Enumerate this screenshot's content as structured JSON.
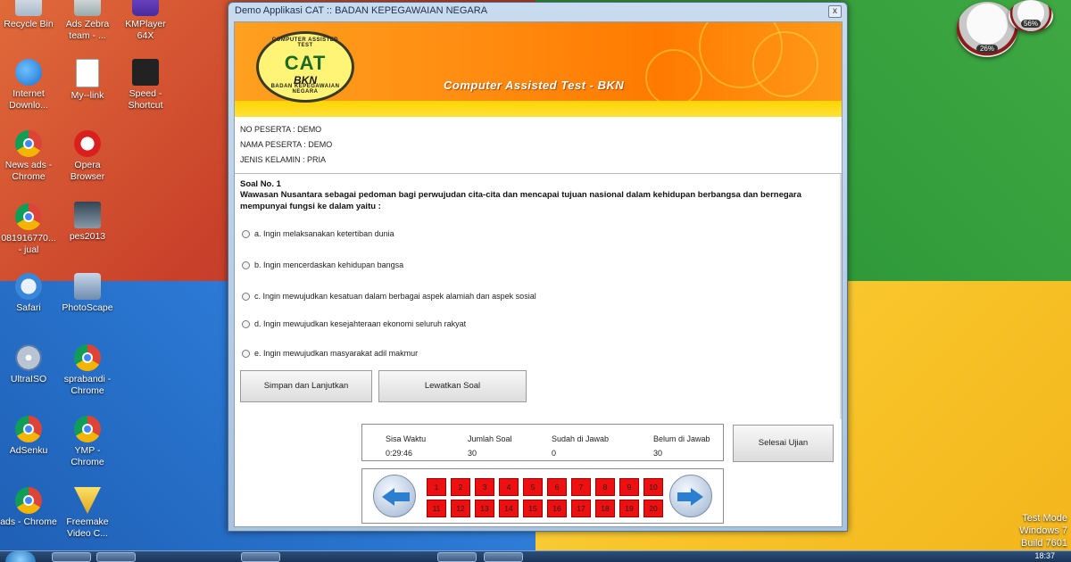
{
  "desktop": {
    "icons": [
      {
        "label": "Recycle Bin",
        "icon": "recycle-bin-icon"
      },
      {
        "label": "Ads Zebra team - ...",
        "icon": "shortcut-icon"
      },
      {
        "label": "KMPlayer 64X",
        "icon": "kmplayer-icon"
      },
      {
        "label": "Internet Downlo...",
        "icon": "download-manager-icon"
      },
      {
        "label": "My--link",
        "icon": "document-icon"
      },
      {
        "label": "Speed - Shortcut",
        "icon": "game-icon"
      },
      {
        "label": "News ads - Chrome",
        "icon": "chrome-icon"
      },
      {
        "label": "Opera Browser",
        "icon": "opera-icon"
      },
      {
        "label": "081916770... - jual",
        "icon": "chrome-icon"
      },
      {
        "label": "pes2013",
        "icon": "game-icon"
      },
      {
        "label": "Safari",
        "icon": "safari-icon"
      },
      {
        "label": "PhotoScape",
        "icon": "photoscape-icon"
      },
      {
        "label": "UltraISO",
        "icon": "disc-icon"
      },
      {
        "label": "sprabandi - Chrome",
        "icon": "chrome-icon"
      },
      {
        "label": "AdSenku",
        "icon": "chrome-icon"
      },
      {
        "label": "YMP - Chrome",
        "icon": "chrome-icon"
      },
      {
        "label": "ads - Chrome",
        "icon": "chrome-icon"
      },
      {
        "label": "Freemake Video C...",
        "icon": "freemake-icon"
      }
    ],
    "gadgets": {
      "cpu": "26%",
      "memory": "56%"
    },
    "watermark": {
      "line1": "Test Mode",
      "line2": "Windows 7",
      "line3": "Build 7601"
    },
    "clock": "18:37"
  },
  "window": {
    "title": "Demo Applikasi CAT :: BADAN KEPEGAWAIAN NEGARA",
    "close_label": "x"
  },
  "banner": {
    "logo_main": "CAT",
    "logo_sub": "BKN",
    "logo_ring_top": "COMPUTER ASSISTED TEST",
    "logo_ring_bottom": "BADAN KEPEGAWAIAN NEGARA",
    "heading": "Computer Assisted Test - BKN"
  },
  "participant": {
    "no": "NO PESERTA :  DEMO",
    "name": "NAMA PESERTA : DEMO",
    "gender": "JENIS KELAMIN : PRIA"
  },
  "question": {
    "number": "Soal No. 1",
    "text": "Wawasan Nusantara sebagai pedoman bagi perwujudan cita-cita dan mencapai tujuan nasional dalam kehidupan berbangsa dan bernegara mempunyai fungsi ke dalam yaitu :",
    "options": [
      "a. Ingin melaksanakan ketertiban dunia",
      "b. Ingin mencerdaskan kehidupan bangsa",
      "c. Ingin mewujudkan kesatuan dalam berbagai aspek alamiah dan aspek sosial",
      "d. Ingin mewujudkan kesejahteraan ekonomi seluruh rakyat",
      "e. Ingin mewujudkan masyarakat adil makmur"
    ]
  },
  "buttons": {
    "save_next": "Simpan dan Lanjutkan",
    "skip": "Lewatkan Soal",
    "finish": "Selesai Ujian"
  },
  "status": {
    "time_label": "Sisa Waktu",
    "time_value": "0:29:46",
    "total_label": "Jumlah Soal",
    "total_value": "30",
    "answered_label": "Sudah di Jawab",
    "answered_value": "0",
    "unanswered_label": "Belum di Jawab",
    "unanswered_value": "30"
  },
  "navigator": {
    "numbers": [
      "1",
      "2",
      "3",
      "4",
      "5",
      "6",
      "7",
      "8",
      "9",
      "10",
      "11",
      "12",
      "13",
      "14",
      "15",
      "16",
      "17",
      "18",
      "19",
      "20"
    ],
    "cell_color": "#ee1010"
  },
  "colors": {
    "banner_orange": "#ff8c10",
    "banner_yellow": "#ffd400",
    "logo_green": "#1d6a24"
  }
}
